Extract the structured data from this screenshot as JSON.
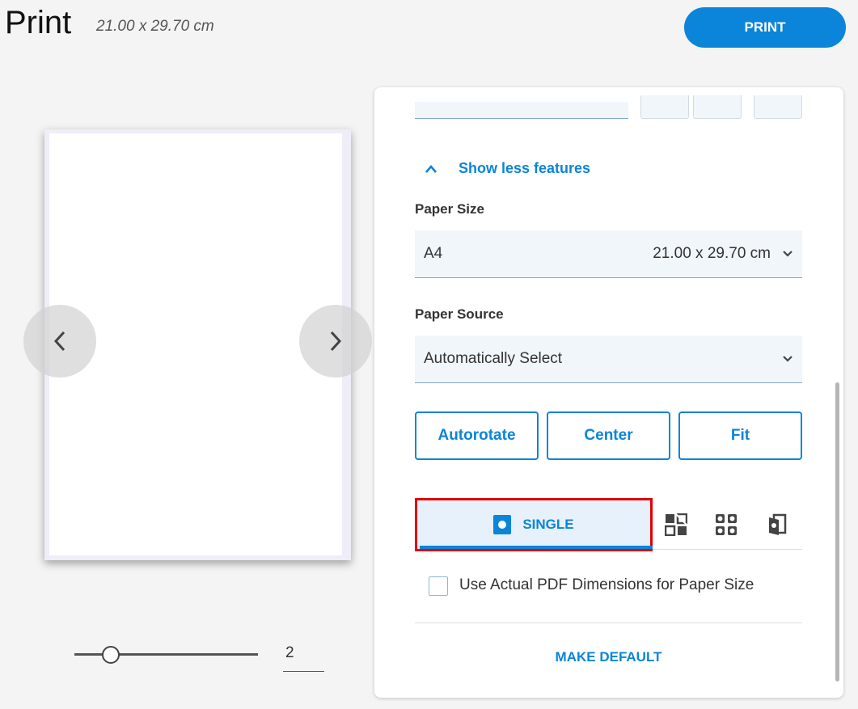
{
  "header": {
    "title": "Print",
    "paper_dimensions": "21.00 x 29.70 cm",
    "print_label": "PRINT"
  },
  "preview": {
    "prev_icon": "chevron-left-icon",
    "next_icon": "chevron-right-icon",
    "page_number": "2"
  },
  "panel": {
    "show_less_label": "Show less features",
    "show_less_icon": "chevron-up-icon",
    "paper_size": {
      "label": "Paper Size",
      "value": "A4",
      "dimensions": "21.00 x 29.70 cm"
    },
    "paper_source": {
      "label": "Paper Source",
      "value": "Automatically Select"
    },
    "fit_buttons": [
      "Autorotate",
      "Center",
      "Fit"
    ],
    "layout": {
      "selected_label": "SINGLE",
      "icons": [
        "single-page-icon",
        "booklet-icon",
        "multiple-pages-icon",
        "tile-icon"
      ]
    },
    "pdf_dimensions_label": "Use Actual PDF Dimensions for Paper Size",
    "pdf_dimensions_checked": false,
    "make_default_label": "MAKE DEFAULT"
  },
  "colors": {
    "accent": "#0a85d9",
    "highlight": "#e00000"
  }
}
